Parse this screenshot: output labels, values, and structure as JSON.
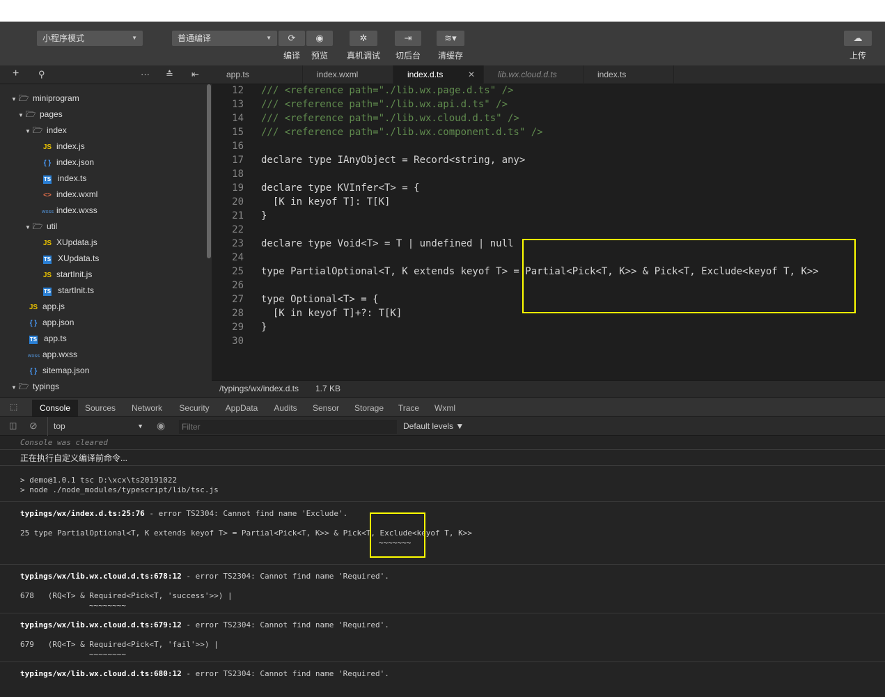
{
  "toolbar": {
    "mode_select": "小程序模式",
    "compile_select": "普通编译",
    "buttons": [
      {
        "label": "编译",
        "icon": "refresh-icon"
      },
      {
        "label": "预览",
        "icon": "eye-icon"
      },
      {
        "label": "真机调试",
        "icon": "bug-icon"
      },
      {
        "label": "切后台",
        "icon": "switch-icon"
      },
      {
        "label": "清缓存",
        "icon": "layers-icon"
      }
    ],
    "upload_label": "上传"
  },
  "tabs": [
    "app.ts",
    "index.wxml",
    "index.d.ts",
    "lib.wx.cloud.d.ts",
    "index.ts"
  ],
  "tree": [
    {
      "label": "miniprogram",
      "type": "folder"
    },
    {
      "label": "pages",
      "type": "folder"
    },
    {
      "label": "index",
      "type": "folder"
    },
    {
      "label": "index.js",
      "type": "js"
    },
    {
      "label": "index.json",
      "type": "json"
    },
    {
      "label": "index.ts",
      "type": "ts"
    },
    {
      "label": "index.wxml",
      "type": "wxml"
    },
    {
      "label": "index.wxss",
      "type": "wxss"
    },
    {
      "label": "util",
      "type": "folder"
    },
    {
      "label": "XUpdata.js",
      "type": "js"
    },
    {
      "label": "XUpdata.ts",
      "type": "ts"
    },
    {
      "label": "startInit.js",
      "type": "js"
    },
    {
      "label": "startInit.ts",
      "type": "ts"
    },
    {
      "label": "app.js",
      "type": "js"
    },
    {
      "label": "app.json",
      "type": "json"
    },
    {
      "label": "app.ts",
      "type": "ts"
    },
    {
      "label": "app.wxss",
      "type": "wxss"
    },
    {
      "label": "sitemap.json",
      "type": "json"
    },
    {
      "label": "typings",
      "type": "folder"
    }
  ],
  "editor": {
    "line_numbers": [
      "12",
      "13",
      "14",
      "15",
      "16",
      "17",
      "18",
      "19",
      "20",
      "21",
      "22",
      "23",
      "24",
      "25",
      "26",
      "27",
      "28",
      "29",
      "30"
    ],
    "lines": [
      "/// <reference path=\"./lib.wx.page.d.ts\" />",
      "/// <reference path=\"./lib.wx.api.d.ts\" />",
      "/// <reference path=\"./lib.wx.cloud.d.ts\" />",
      "/// <reference path=\"./lib.wx.component.d.ts\" />",
      "",
      "declare type IAnyObject = Record<string, any>",
      "",
      "declare type KVInfer<T> = {",
      "  [K in keyof T]: T[K]",
      "}",
      "",
      "declare type Void<T> = T | undefined | null",
      "",
      "type PartialOptional<T, K extends keyof T> = Partial<Pick<T, K>> & Pick<T, Exclude<keyof T, K>>",
      "",
      "type Optional<T> = {",
      "  [K in keyof T]+?: T[K]",
      "}",
      ""
    ]
  },
  "status": {
    "path": "/typings/wx/index.d.ts",
    "size": "1.7 KB"
  },
  "devtools": {
    "tabs": [
      "Console",
      "Sources",
      "Network",
      "Security",
      "AppData",
      "Audits",
      "Sensor",
      "Storage",
      "Trace",
      "Wxml"
    ],
    "context": "top",
    "filter_placeholder": "Filter",
    "levels": "Default levels ▼"
  },
  "console": {
    "cleared": "Console was cleared",
    "running": "正在执行自定义编译前命令...",
    "cmd1": "> demo@1.0.1 tsc D:\\xcx\\ts20191022",
    "cmd2": "> node ./node_modules/typescript/lib/tsc.js",
    "err1_file": "typings/wx/index.d.ts:25:76",
    "err1_msg": " - error TS2304: Cannot find name 'Exclude'.",
    "err1_code": "25 type PartialOptional<T, K extends keyof T> = Partial<Pick<T, K>> & Pick<T, Exclude<keyof T, K>>",
    "err1_squig": "~~~~~~~",
    "err2_file": "typings/wx/lib.wx.cloud.d.ts:678:12",
    "err2_msg": " - error TS2304: Cannot find name 'Required'.",
    "err2_code": "678   (RQ<T> & Required<Pick<T, 'success'>>) |",
    "err2_squig": "~~~~~~~~",
    "err3_file": "typings/wx/lib.wx.cloud.d.ts:679:12",
    "err3_msg": " - error TS2304: Cannot find name 'Required'.",
    "err3_code": "679   (RQ<T> & Required<Pick<T, 'fail'>>) |",
    "err3_squig": "~~~~~~~~",
    "err4_file": "typings/wx/lib.wx.cloud.d.ts:680:12",
    "err4_msg": " - error TS2304: Cannot find name 'Required'."
  }
}
